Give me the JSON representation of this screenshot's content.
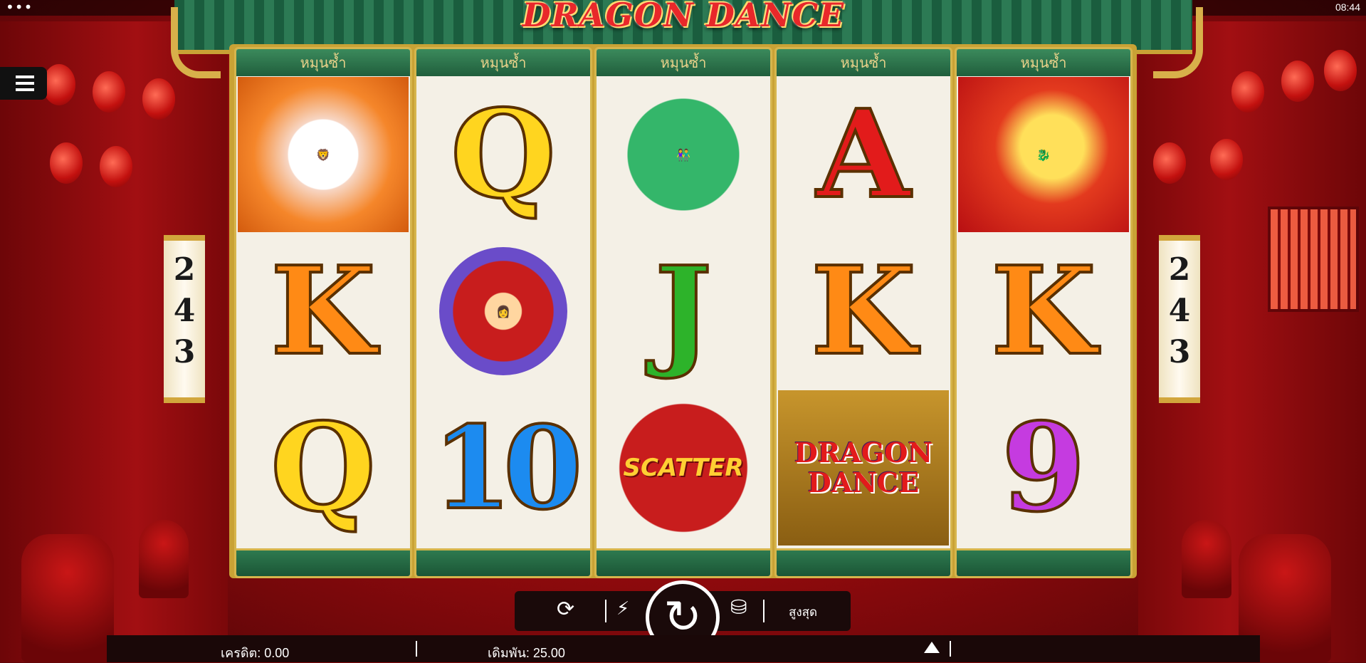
{
  "status_bar": {
    "dots": "•••",
    "time": "08:44"
  },
  "game": {
    "logo_line1": "DRAGON",
    "logo_line2": "DANCE"
  },
  "reels": [
    {
      "header": "หมุนซ้ำ",
      "symbols": [
        "lion-dance",
        "K",
        "Q"
      ]
    },
    {
      "header": "หมุนซ้ำ",
      "symbols": [
        "Q",
        "cymbal-girl",
        "10"
      ]
    },
    {
      "header": "หมุนซ้ำ",
      "symbols": [
        "dancers",
        "J",
        "SCATTER"
      ]
    },
    {
      "header": "หมุนซ้ำ",
      "symbols": [
        "A",
        "K",
        "DRAGON DANCE"
      ]
    },
    {
      "header": "หมุนซ้ำ",
      "symbols": [
        "dragon",
        "K",
        "9"
      ]
    }
  ],
  "ways": {
    "left": [
      "2",
      "4",
      "3"
    ],
    "right": [
      "2",
      "4",
      "3"
    ]
  },
  "controls": {
    "autoplay_icon": "autoplay-icon",
    "turbo_icon": "lightning-icon",
    "spin_icon": "spin-icon",
    "coins_icon": "coins-icon",
    "max_bet_label": "สูงสุด"
  },
  "info": {
    "credit_label": "เครดิต: 0.00",
    "bet_label": "เดิมพัน: 25.00"
  },
  "colors": {
    "reel_header": "#2c7a54",
    "gold": "#c9a235",
    "background": "#b3121a"
  }
}
